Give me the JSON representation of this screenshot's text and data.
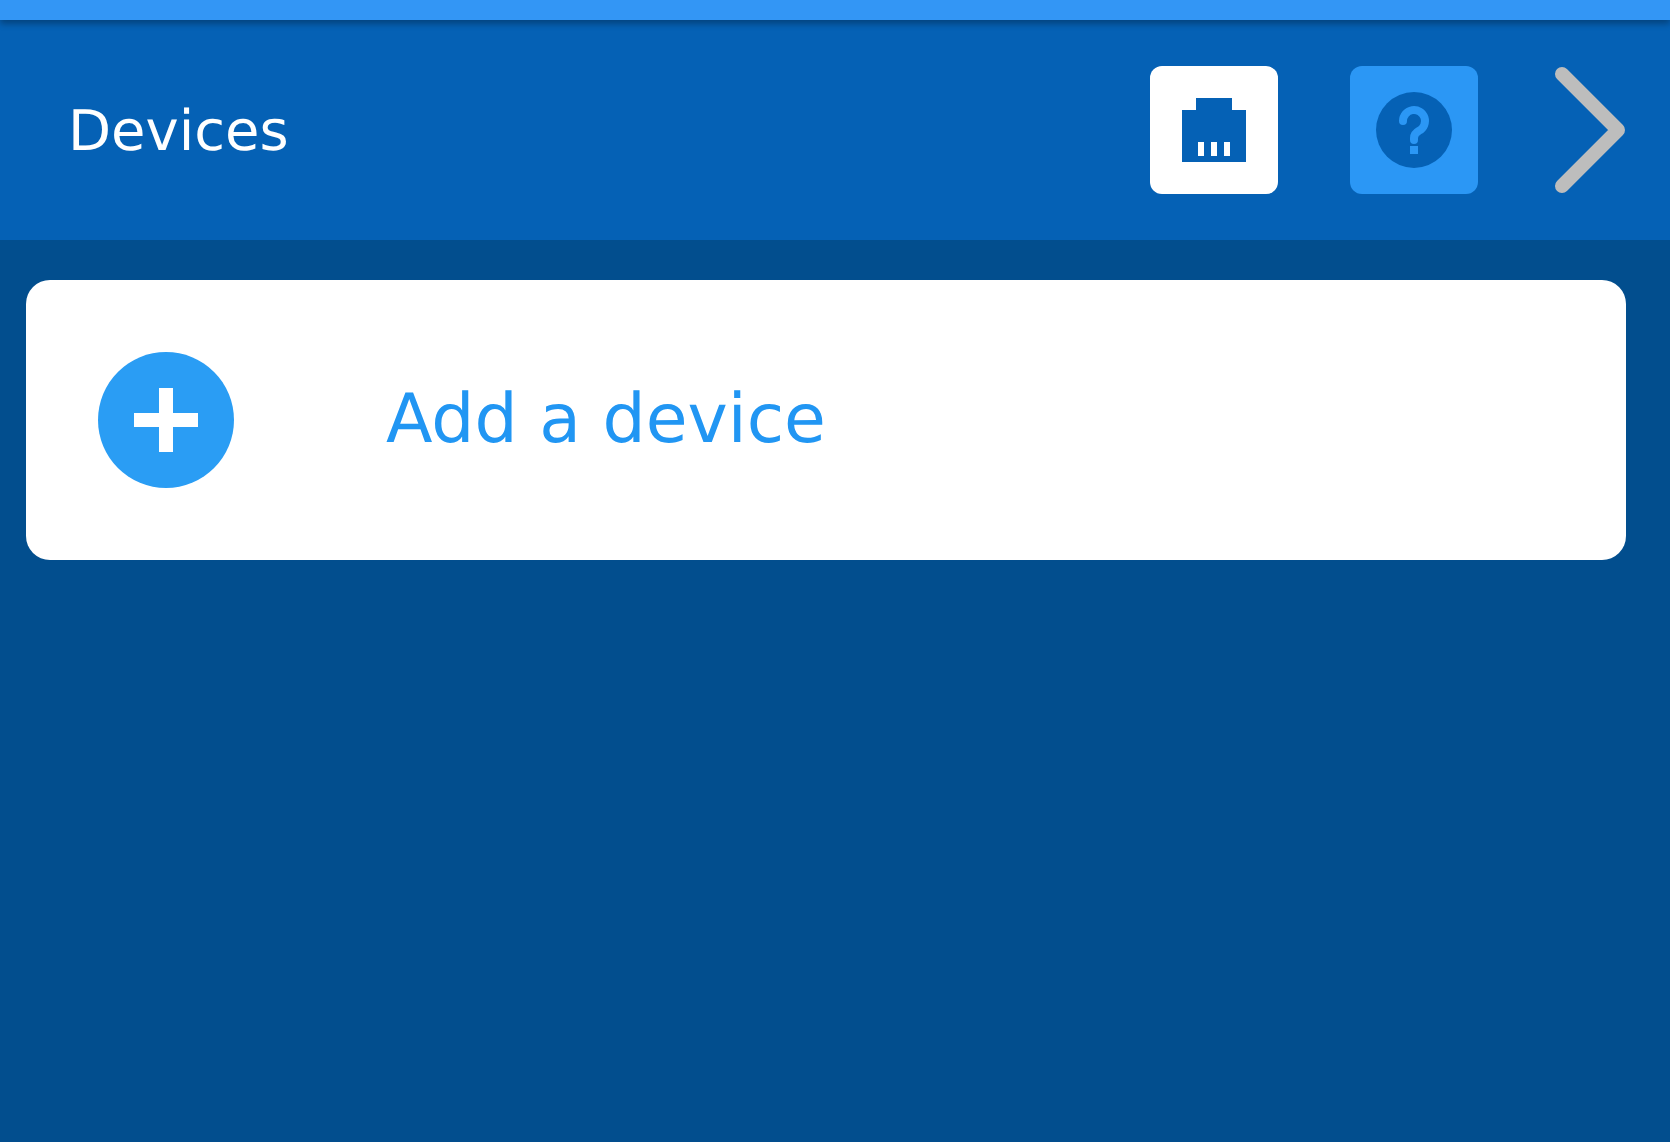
{
  "header": {
    "title": "Devices"
  },
  "add_card": {
    "label": "Add a device"
  }
}
